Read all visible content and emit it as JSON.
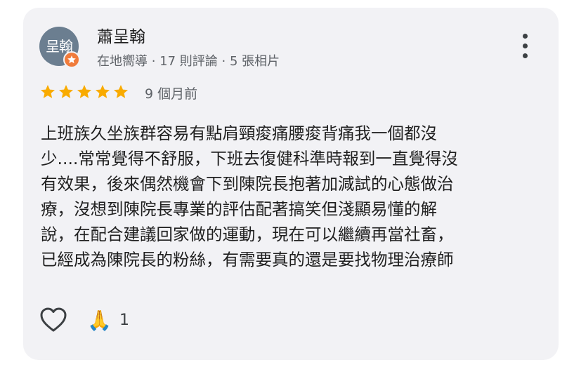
{
  "review": {
    "author_name": "蕭呈翰",
    "avatar_text": "呈翰",
    "author_meta": "在地嚮導 · 17 則評論 · 5 張相片",
    "rating": 5,
    "star_color": "#f9ab00",
    "date": "9 個月前",
    "text_lines": [
      "上班族久坐族群容易有點肩頸痠痛腰痠背痛我一個都沒",
      "少....常常覺得不舒服，下班去復健科準時報到一直覺得沒",
      "有效果，後來偶然機會下到陳院長抱著加減試的心態做治",
      "療，沒想到陳院長專業的評估配著搞笑但淺顯易懂的解",
      "說，在配合建議回家做的運動，現在可以繼續再當社畜，",
      "已經成為陳院長的粉絲，有需要真的還是要找物理治療師"
    ],
    "reaction_emoji": "🙏",
    "reaction_count": "1"
  },
  "icons": {
    "badge": "local-guide-star-icon",
    "more": "more-vert-icon",
    "like": "heart-outline-icon",
    "reaction": "folded-hands-icon"
  },
  "colors": {
    "card_background": "#f2f2f5",
    "avatar_background": "#6b7e90",
    "badge": "#f07b3b"
  }
}
